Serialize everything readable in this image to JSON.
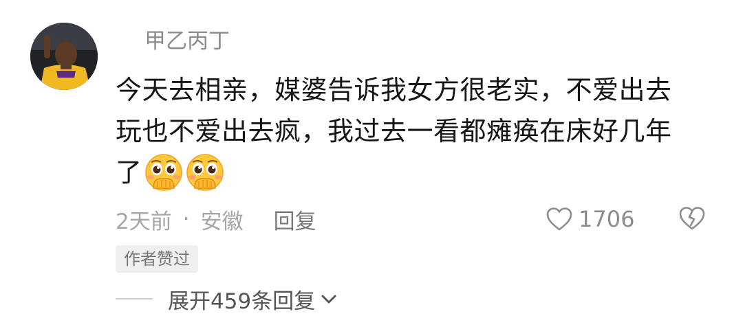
{
  "comment": {
    "username": "甲乙丙丁",
    "content_lines": [
      "今天去相亲，媒婆告诉我女方很老实，不爱出去",
      "玩也不爱出去疯，我过去一看都瘫痪在床好几年",
      "了"
    ],
    "emojis": [
      "pleading-face-emoji",
      "pleading-face-emoji"
    ],
    "time": "2天前",
    "separator": "·",
    "location": "安徽",
    "reply_label": "回复",
    "like_count": "1706",
    "author_badge": "作者赞过",
    "expand_label": "展开459条回复"
  },
  "icons": {
    "like": "heart-outline-icon",
    "dislike": "broken-heart-icon",
    "expand": "chevron-down-icon"
  },
  "colors": {
    "text_primary": "#161616",
    "text_secondary": "#8c8c8c",
    "emoji_yellow": "#ffc83d",
    "badge_bg": "#efefef"
  }
}
